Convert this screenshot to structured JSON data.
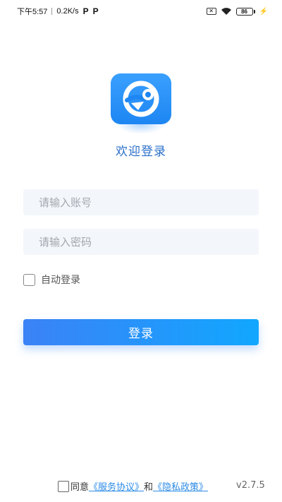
{
  "status_bar": {
    "time": "下午5:57",
    "net_speed": "0.2K/s",
    "p_icon_1": "P",
    "p_icon_2": "P",
    "battery_level": "86",
    "battery_fraction": 0.86
  },
  "logo": {
    "icon": "app-logo-icon",
    "color": "#2b8ff5"
  },
  "welcome": "欢迎登录",
  "form": {
    "account_placeholder": "请输入账号",
    "password_placeholder": "请输入密码",
    "auto_login_label": "自动登录",
    "login_button": "登录"
  },
  "footer": {
    "agree_label": "同意",
    "service_link": "《服务协议》",
    "and_text": "和",
    "privacy_link": "《隐私政策》",
    "version": "v2.7.5"
  },
  "colors": {
    "accent": "#1e90ff",
    "link": "#2b8be6",
    "field_bg": "#f3f6fb"
  }
}
